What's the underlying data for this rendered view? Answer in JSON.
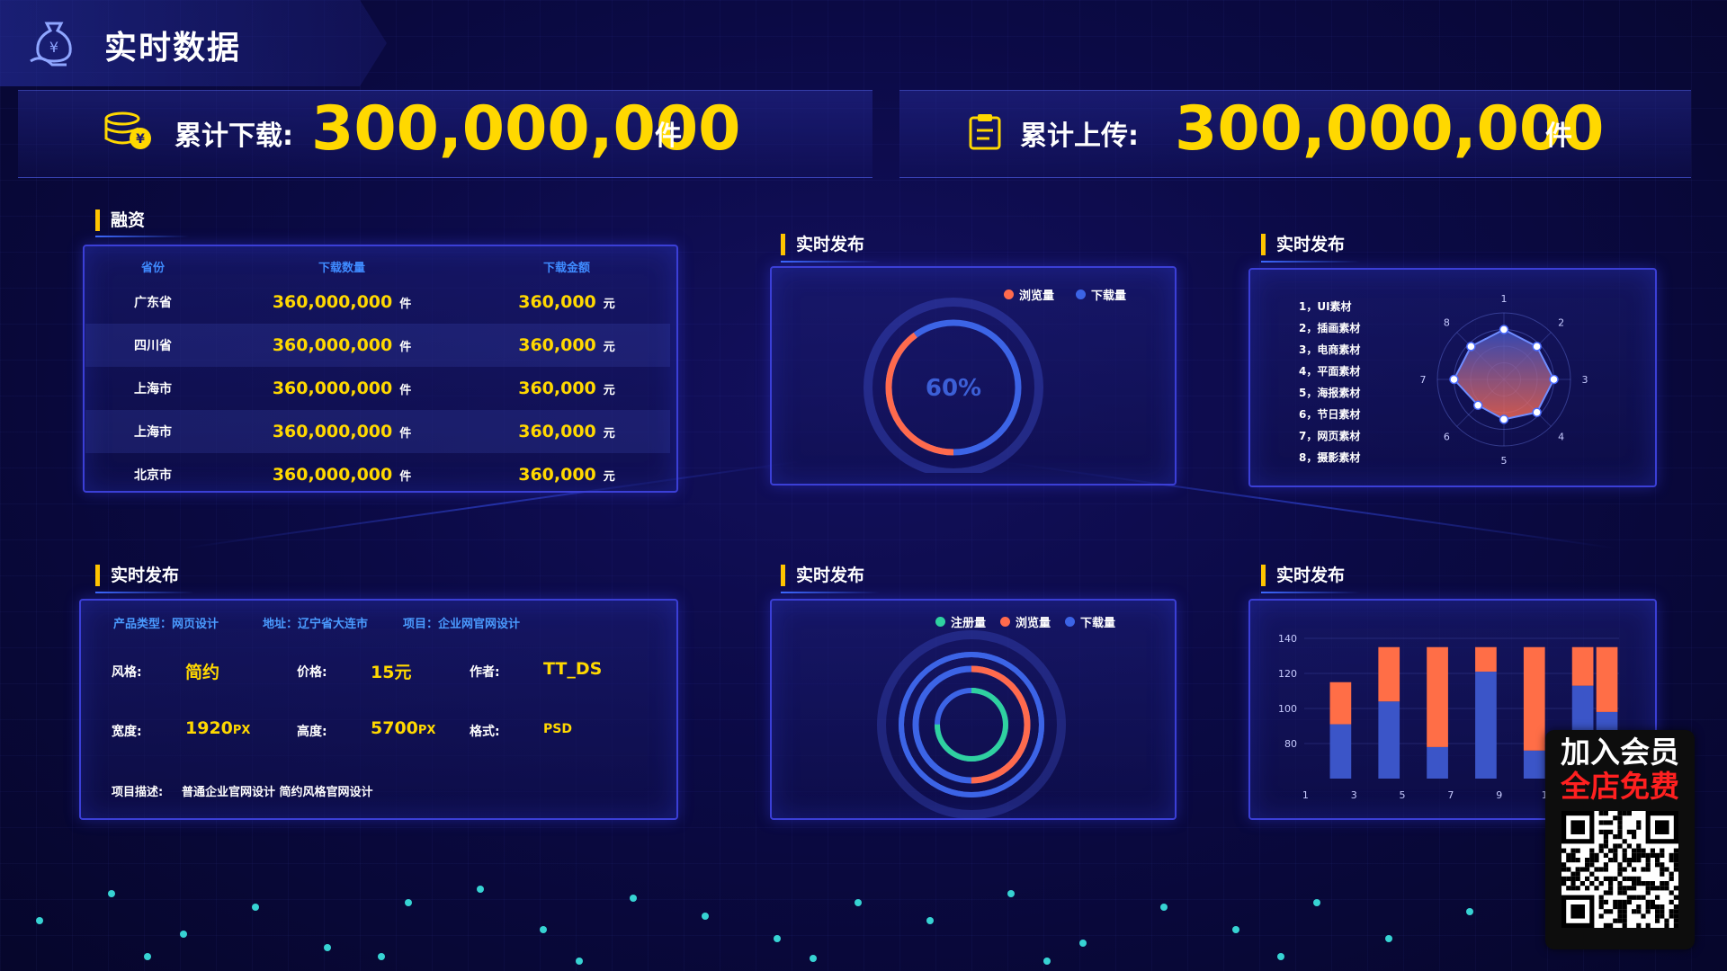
{
  "header": {
    "title": "实时数据"
  },
  "stats": {
    "download": {
      "label": "累计下载:",
      "value": "300,000,000",
      "unit": "件"
    },
    "upload": {
      "label": "累计上传:",
      "value": "300,000,000",
      "unit": "件"
    }
  },
  "finance": {
    "title": "融资",
    "columns": [
      "省份",
      "下载数量",
      "下载金额"
    ],
    "rows": [
      {
        "province": "广东省",
        "count": "360,000,000",
        "count_unit": "件",
        "amount": "360,000",
        "amount_unit": "元"
      },
      {
        "province": "四川省",
        "count": "360,000,000",
        "count_unit": "件",
        "amount": "360,000",
        "amount_unit": "元"
      },
      {
        "province": "上海市",
        "count": "360,000,000",
        "count_unit": "件",
        "amount": "360,000",
        "amount_unit": "元"
      },
      {
        "province": "上海市",
        "count": "360,000,000",
        "count_unit": "件",
        "amount": "360,000",
        "amount_unit": "元"
      },
      {
        "province": "北京市",
        "count": "360,000,000",
        "count_unit": "件",
        "amount": "360,000",
        "amount_unit": "元"
      }
    ]
  },
  "gauge": {
    "title": "实时发布",
    "percent_label": "60%",
    "legend": [
      {
        "name": "浏览量",
        "color": "#ff6a4d"
      },
      {
        "name": "下载量",
        "color": "#3c64e6"
      }
    ],
    "chart_data": {
      "type": "pie",
      "values": [
        60
      ],
      "max": 100
    }
  },
  "radar": {
    "title": "实时发布",
    "items": [
      "1，UI素材",
      "2，插画素材",
      "3，电商素材",
      "4，平面素材",
      "5，海报素材",
      "6，节日素材",
      "7，网页素材",
      "8，摄影素材"
    ],
    "axes": [
      "1",
      "2",
      "3",
      "4",
      "5",
      "6",
      "7",
      "8"
    ],
    "chart_data": {
      "type": "radar",
      "axes": [
        "1",
        "2",
        "3",
        "4",
        "5",
        "6",
        "7",
        "8"
      ],
      "values": [
        0.75,
        0.7,
        0.75,
        0.7,
        0.6,
        0.55,
        0.75,
        0.7
      ],
      "max": 1
    }
  },
  "project": {
    "title": "实时发布",
    "info": [
      "产品类型：网页设计",
      "地址：辽宁省大连市",
      "项目：企业网官网设计"
    ],
    "fields": [
      {
        "label": "风格:",
        "value": "简约",
        "suffix": ""
      },
      {
        "label": "价格:",
        "value": "15元",
        "suffix": ""
      },
      {
        "label": "作者:",
        "value": "TT_DS",
        "suffix": ""
      },
      {
        "label": "宽度:",
        "value": "1920",
        "suffix": "PX"
      },
      {
        "label": "高度:",
        "value": "5700",
        "suffix": "PX"
      },
      {
        "label": "格式:",
        "value": "PSD",
        "suffix": ""
      }
    ],
    "desc_label": "项目描述:",
    "desc": "普通企业官网设计 简约风格官网设计"
  },
  "rings": {
    "title": "实时发布",
    "legend": [
      {
        "name": "注册量",
        "color": "#2fd1a0"
      },
      {
        "name": "浏览量",
        "color": "#ff6a4d"
      },
      {
        "name": "下载量",
        "color": "#3c64e6"
      }
    ],
    "chart_data": {
      "type": "pie",
      "series": [
        {
          "name": "注册量",
          "values": [
            0.75
          ]
        },
        {
          "name": "浏览量",
          "values": [
            0.5
          ]
        },
        {
          "name": "下载量",
          "values": [
            1.0
          ]
        }
      ]
    }
  },
  "bars": {
    "title": "实时发布",
    "chart_data": {
      "type": "bar",
      "stacked": true,
      "x": [
        "1",
        "2",
        "3",
        "4",
        "5",
        "6",
        "7",
        "8",
        "9",
        "10",
        "11",
        "12",
        "13"
      ],
      "tick_labels": [
        "1",
        "3",
        "5",
        "7",
        "9",
        "11"
      ],
      "yticks": [
        "140",
        "120",
        "100",
        "80"
      ],
      "ylim": [
        60,
        140
      ],
      "series": [
        {
          "color": "#3b55c8",
          "values": [
            null,
            91,
            null,
            104,
            null,
            78,
            null,
            121,
            null,
            76,
            null,
            113,
            98
          ]
        },
        {
          "color": "#ff6e47",
          "values": [
            null,
            115,
            null,
            135,
            null,
            135,
            null,
            135,
            null,
            135,
            null,
            135,
            135
          ]
        }
      ]
    }
  },
  "promo": {
    "line1": "加入会员",
    "line2": "全店免费"
  },
  "colors": {
    "accent": "#ffd800",
    "panel_border": "#3b3fd6",
    "title_bar": "#ffc400"
  }
}
